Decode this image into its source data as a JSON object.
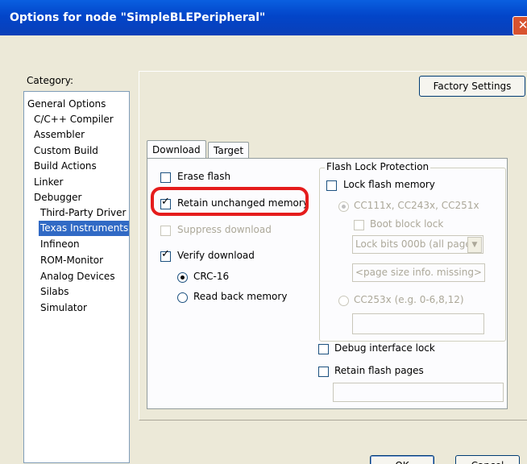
{
  "window": {
    "title": "Options for node \"SimpleBLEPeripheral\"",
    "close_glyph": "✕"
  },
  "category": {
    "label": "Category:",
    "items": [
      {
        "label": "General Options"
      },
      {
        "label": "C/C++ Compiler"
      },
      {
        "label": "Assembler"
      },
      {
        "label": "Custom Build"
      },
      {
        "label": "Build Actions"
      },
      {
        "label": "Linker"
      },
      {
        "label": "Debugger"
      },
      {
        "label": "Third-Party Driver"
      },
      {
        "label": "Texas Instruments"
      },
      {
        "label": "Infineon"
      },
      {
        "label": "ROM-Monitor"
      },
      {
        "label": "Analog Devices"
      },
      {
        "label": "Silabs"
      },
      {
        "label": "Simulator"
      }
    ],
    "selected": "Texas Instruments"
  },
  "factory_settings": "Factory Settings",
  "tabs": [
    {
      "label": "Download",
      "active": true
    },
    {
      "label": "Target",
      "active": false
    }
  ],
  "download": {
    "erase_flash": {
      "label": "Erase flash",
      "checked": false,
      "enabled": true
    },
    "retain_unchanged": {
      "label": "Retain unchanged  memory",
      "checked": true,
      "enabled": true,
      "highlighted": true
    },
    "suppress_download": {
      "label": "Suppress download",
      "checked": false,
      "enabled": false
    },
    "verify_download": {
      "label": "Verify download",
      "checked": true,
      "enabled": true
    },
    "crc16": {
      "label": "CRC-16",
      "selected": true
    },
    "read_back": {
      "label": "Read back memory",
      "selected": false
    }
  },
  "flash_lock": {
    "title": "Flash Lock Protection",
    "lock_flash_memory": {
      "label": "Lock flash memory",
      "checked": false
    },
    "cc111x": {
      "label": "CC111x, CC243x, CC251x",
      "selected": true,
      "enabled": false
    },
    "boot_block_lock": {
      "label": "Boot block lock",
      "checked": false,
      "enabled": false
    },
    "lock_bits": {
      "value": "Lock bits 000b (all page"
    },
    "page_size": {
      "value": "<page size info. missing>"
    },
    "cc253x": {
      "label": "CC253x (e.g. 0-6,8,12)",
      "selected": false,
      "enabled": false
    },
    "cc253x_input": {
      "value": ""
    }
  },
  "debug_interface_lock": {
    "label": "Debug interface lock",
    "checked": false
  },
  "retain_flash_pages": {
    "label": "Retain flash pages",
    "checked": false,
    "input_value": ""
  },
  "buttons": {
    "ok": "OK",
    "cancel": "Cancel"
  },
  "colors": {
    "titlebar": "#0245c9",
    "selection": "#316ac5",
    "highlight_box": "#e51c1c"
  }
}
